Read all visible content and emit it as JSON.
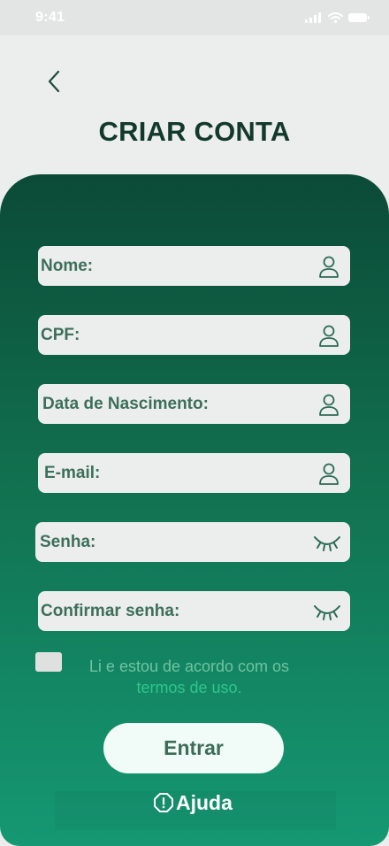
{
  "status_bar": {
    "time": "9:41"
  },
  "header": {
    "title": "CRIAR CONTA"
  },
  "form": {
    "fields": [
      {
        "label": "Nome:",
        "icon": "user-icon"
      },
      {
        "label": "CPF:",
        "icon": "user-icon"
      },
      {
        "label": "Data de Nascimento:",
        "icon": "user-icon"
      },
      {
        "label": "E-mail:",
        "icon": "user-icon"
      },
      {
        "label": "Senha:",
        "icon": "eye-closed-icon"
      },
      {
        "label": "Confirmar senha:",
        "icon": "eye-closed-icon"
      }
    ],
    "terms_text": "Li e estou de acordo com os",
    "terms_link": "termos de uso.",
    "submit_label": "Entrar",
    "help_label": "Ajuda"
  },
  "colors": {
    "title": "#12392b",
    "panel_top": "#0b4a37",
    "panel_bottom": "#159873",
    "field_bg": "#eceeed",
    "field_text": "#3d6f5b",
    "link": "#2fc58c"
  }
}
